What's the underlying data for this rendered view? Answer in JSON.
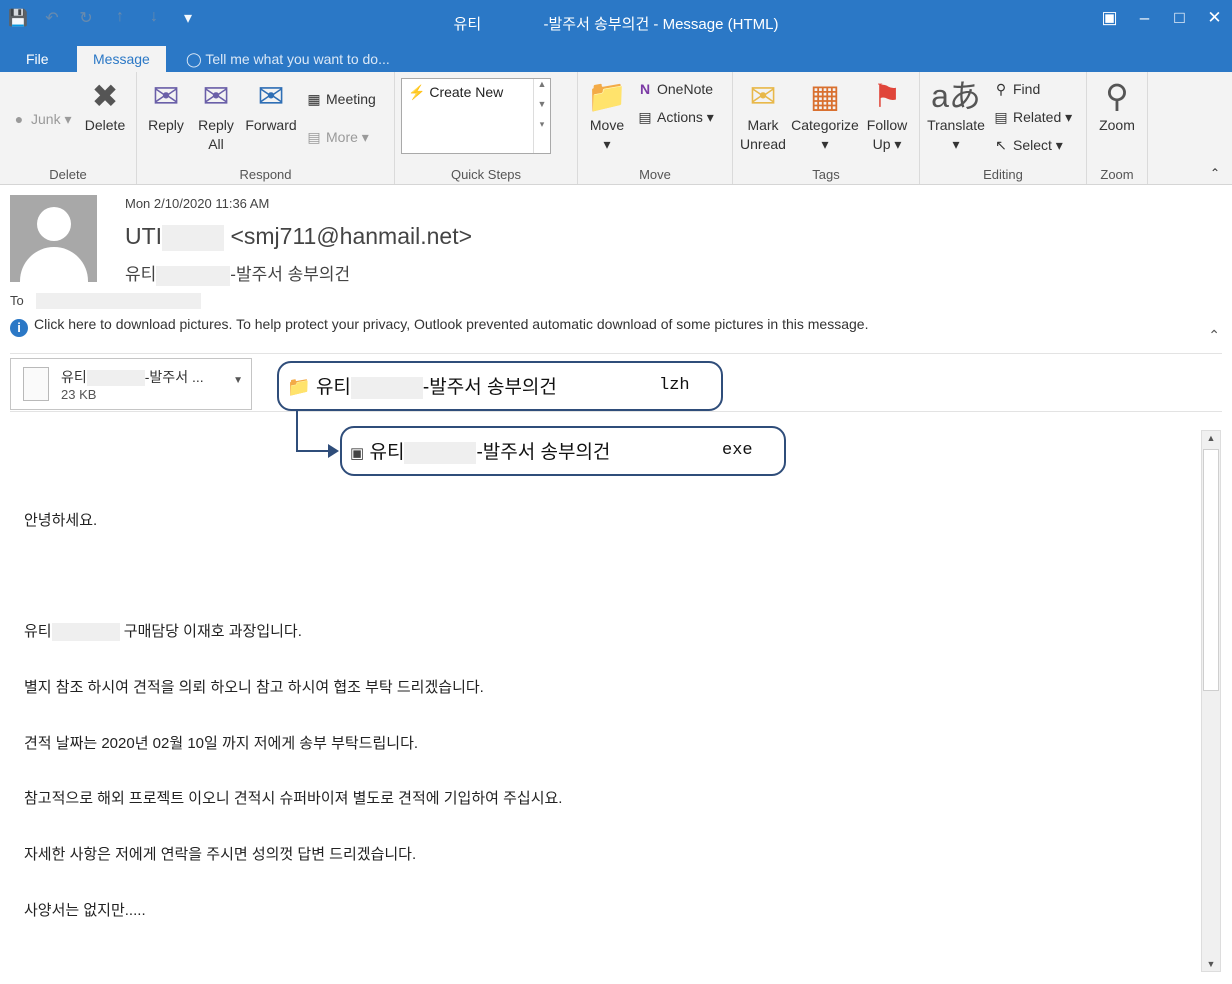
{
  "window": {
    "title_prefix": "유티",
    "title_suffix": "-발주서 송부의건 - Message (HTML)",
    "controls": [
      "restore-down",
      "minimize",
      "maximize",
      "close"
    ]
  },
  "tabs": [
    {
      "label": "File"
    },
    {
      "label": "Message"
    },
    {
      "label": "Tell me what you want to do..."
    }
  ],
  "ribbon": {
    "delete": {
      "group": "Delete",
      "junk": "Junk",
      "delete": "Delete"
    },
    "respond": {
      "group": "Respond",
      "reply": "Reply",
      "reply_all_1": "Reply",
      "reply_all_2": "All",
      "forward": "Forward",
      "meeting": "Meeting",
      "more": "More"
    },
    "quick_steps": {
      "group": "Quick Steps",
      "create_new": "Create New"
    },
    "move": {
      "group": "Move",
      "move": "Move",
      "onenote": "OneNote",
      "actions": "Actions"
    },
    "tags": {
      "group": "Tags",
      "mark_unread_1": "Mark",
      "mark_unread_2": "Unread",
      "categorize": "Categorize",
      "follow_up_1": "Follow",
      "follow_up_2": "Up"
    },
    "editing": {
      "group": "Editing",
      "translate": "Translate",
      "find": "Find",
      "related": "Related",
      "select": "Select"
    },
    "zoom": {
      "group": "Zoom",
      "zoom": "Zoom"
    }
  },
  "message": {
    "date": "Mon 2/10/2020 11:36 AM",
    "sender_prefix": "UTI",
    "sender_email": "<smj711@hanmail.net>",
    "subject_prefix": "유티",
    "subject_suffix": "-발주서 송부의건",
    "to_label": "To",
    "info_bar": "Click here to download pictures. To help protect your privacy, Outlook prevented automatic download of some pictures in this message."
  },
  "attachment": {
    "name_prefix": "유티",
    "name_suffix": "-발주서 ...",
    "size": "23 KB"
  },
  "callouts": [
    {
      "prefix": "유티",
      "suffix": "-발주서  송부의건",
      "ext": "lzh"
    },
    {
      "prefix": "유티",
      "suffix": "-발주서  송부의건",
      "ext": "exe"
    }
  ],
  "body": {
    "greeting": "안녕하세요.",
    "line1_prefix": "유티",
    "line1_suffix": "구매담당 이재호 과장입니다.",
    "line2": "별지 참조 하시여 견적을 의뢰 하오니 참고 하시여 협조 부탁 드리겠습니다.",
    "line3": "견적 날짜는 2020년 02월 10일 까지 저에게 송부 부탁드립니다.",
    "line4": "참고적으로 해외 프로젝트 이오니 견적시 슈퍼바이져 별도로 견적에 기입하여 주십시요.",
    "line5": "자세한 사항은 저에게 연락을 주시면 성의껏 답변 드리겠습니다.",
    "line6": "사양서는 없지만....."
  }
}
